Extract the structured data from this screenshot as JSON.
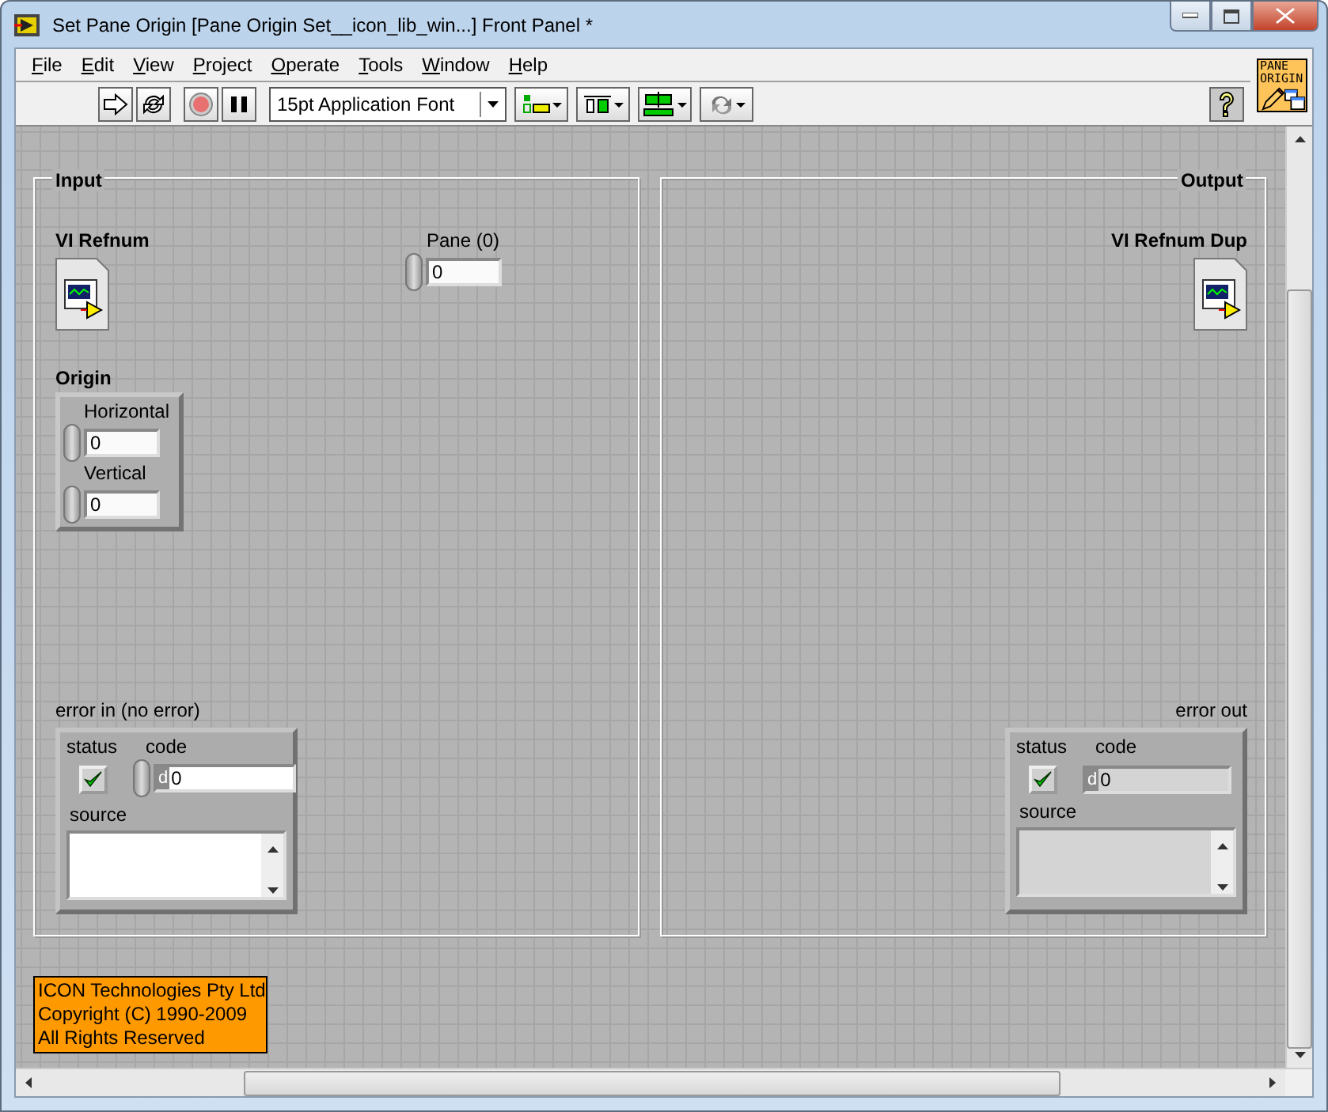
{
  "window": {
    "title": "Set Pane Origin [Pane Origin Set__icon_lib_win...] Front Panel *"
  },
  "menu": [
    {
      "label": "File"
    },
    {
      "label": "Edit"
    },
    {
      "label": "View"
    },
    {
      "label": "Project"
    },
    {
      "label": "Operate"
    },
    {
      "label": "Tools"
    },
    {
      "label": "Window"
    },
    {
      "label": "Help"
    }
  ],
  "toolbar": {
    "font": "15pt Application Font"
  },
  "vi_icon": {
    "lines": [
      "PANE",
      "ORIGIN"
    ]
  },
  "sections": [
    {
      "label": "Input",
      "items": [
        {
          "kind": "refnum",
          "label": "VI Refnum"
        },
        {
          "kind": "numeric",
          "label": "Pane (0)",
          "value": "0",
          "indicator": false
        },
        {
          "kind": "cluster",
          "label": "Origin",
          "fields": [
            {
              "label": "Horizontal",
              "value": "0"
            },
            {
              "label": "Vertical",
              "value": "0"
            }
          ]
        },
        {
          "kind": "error",
          "label": "error in (no error)",
          "indicator": false,
          "status_label": "status",
          "status": true,
          "code_label": "code",
          "radix": "d",
          "code": "0",
          "source_label": "source"
        }
      ]
    },
    {
      "label": "Output",
      "items": [
        {
          "kind": "refnum",
          "label": "VI Refnum Dup"
        },
        {
          "kind": "error",
          "label": "error out",
          "indicator": true,
          "status_label": "status",
          "status": true,
          "code_label": "code",
          "radix": "d",
          "code": "0",
          "source_label": "source"
        }
      ]
    }
  ],
  "copyright": [
    "ICON Technologies Pty Ltd",
    "Copyright (C) 1990-2009",
    "All Rights Reserved"
  ]
}
